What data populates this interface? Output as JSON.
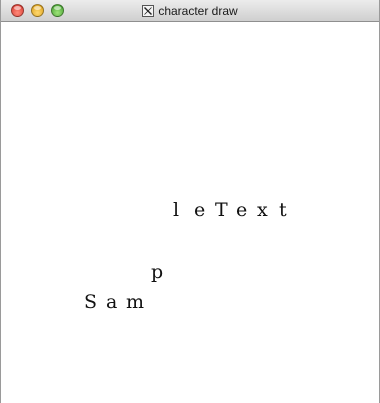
{
  "window": {
    "title": "character draw"
  },
  "canvas": {
    "glyphs": {
      "g_l": "l",
      "g_e1": "e",
      "g_T": "T",
      "g_e2": "e",
      "g_x": "x",
      "g_t": "t",
      "g_p": "p",
      "g_S": "S",
      "g_a": "a",
      "g_m": "m"
    }
  },
  "icons": {
    "app": "x11-icon",
    "close": "close-button-icon",
    "minimize": "minimize-button-icon",
    "zoom": "zoom-button-icon"
  }
}
